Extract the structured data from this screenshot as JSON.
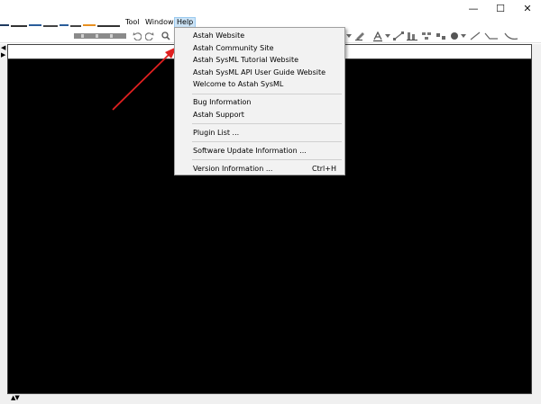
{
  "window": {
    "minimize_glyph": "—",
    "maximize_glyph": "☐",
    "close_glyph": "✕"
  },
  "menubar": {
    "items": [
      {
        "label": "Tool"
      },
      {
        "label": "Window"
      },
      {
        "label": "Help"
      }
    ]
  },
  "help_menu": {
    "groups": [
      [
        "Astah Website",
        "Astah Community Site",
        "Astah SysML Tutorial Website",
        "Astah SysML API User Guide Website",
        "Welcome to Astah SysML"
      ],
      [
        "Bug Information",
        "Astah Support"
      ],
      [
        "Plugin List ..."
      ],
      [
        "Software Update Information ..."
      ],
      [
        "Version Information ..."
      ]
    ],
    "version_shortcut": "Ctrl+H"
  },
  "toolbar": {
    "icons": [
      "undo-icon",
      "redo-icon",
      "zoom-icon",
      "pen-icon",
      "font-color-icon",
      "line-style-icon",
      "align-icon",
      "distribute-icon",
      "circle-fill-icon",
      "line-icon",
      "connector-icon"
    ]
  },
  "colors": {
    "menu_active_bg": "#cce4f7",
    "menu_active_border": "#99c9ef",
    "canvas_bg": "#000000",
    "annotation_arrow": "#e02020",
    "dropdown_bg": "#f2f2f2"
  }
}
